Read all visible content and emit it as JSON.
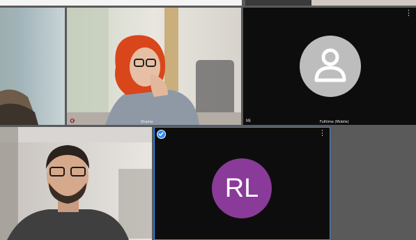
{
  "colors": {
    "background": "#5a5a5a",
    "tile_background": "#111111",
    "active_speaker_border": "#2d8cff",
    "avatar_purple": "#8a3a99",
    "avatar_gray": "#bdbdbd"
  },
  "icons": {
    "more_options": "⋮",
    "person_placeholder": "person-icon",
    "selected_check": "check-icon"
  },
  "participants": [
    {
      "id": "p1",
      "name": "",
      "mic_label": "",
      "video": "on"
    },
    {
      "id": "p2",
      "name": "Shama",
      "mic_label": "",
      "video": "on"
    },
    {
      "id": "p3",
      "name": "Fulltime (Mobile)",
      "mic_label": "Mi",
      "video": "off"
    },
    {
      "id": "p4",
      "name": "",
      "mic_label": "",
      "video": "on"
    },
    {
      "id": "p5",
      "name": "",
      "initials": "RL",
      "video": "off",
      "active_speaker": true
    }
  ]
}
